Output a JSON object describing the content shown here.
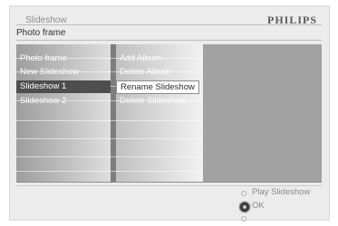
{
  "header": {
    "title": "Slideshow",
    "brand": "PHILIPS"
  },
  "breadcrumb": "Photo frame",
  "left_menu": {
    "items": [
      {
        "label": "Photo frame"
      },
      {
        "label": "New Slideshow"
      },
      {
        "label": "Slideshow 1",
        "selected": true
      },
      {
        "label": "Slideshow 2"
      }
    ]
  },
  "context_menu": {
    "items": [
      {
        "label": "Add Album"
      },
      {
        "label": "Delete Album"
      },
      {
        "label": "Rename Slideshow",
        "highlighted": true
      },
      {
        "label": "Delete Slideshow"
      }
    ]
  },
  "footer": {
    "play_label": "Play Slideshow",
    "ok_label": "OK"
  },
  "colors": {
    "selected_bg": "#4e4e4e",
    "highlight_bg": "#ffffff",
    "panel_bg": "#a2a2a2"
  }
}
